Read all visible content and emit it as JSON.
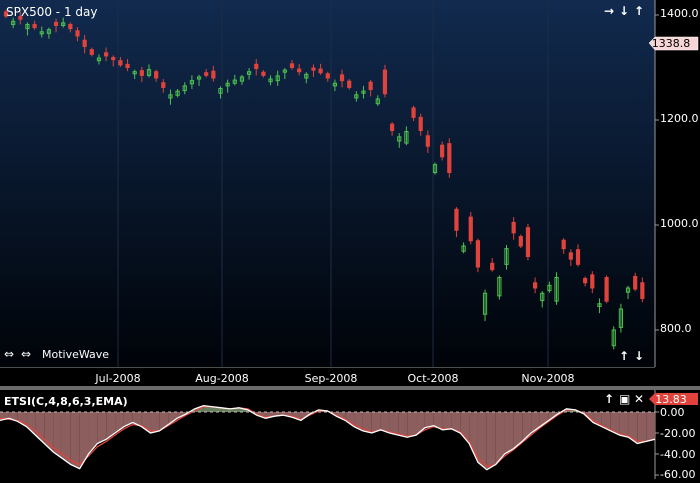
{
  "price_panel": {
    "title": "SPX500 - 1 day",
    "last_price": "1338.8",
    "price_ticks": [
      "1400.0",
      "1200.0",
      "1000.0",
      "800.0"
    ],
    "brand": "MotiveWave",
    "controls": {
      "top": [
        "→",
        "↓",
        "↑"
      ],
      "bottom": [
        "↑",
        "↓"
      ]
    }
  },
  "time_axis": {
    "labels": [
      "Jul-2008",
      "Aug-2008",
      "Sep-2008",
      "Oct-2008",
      "Nov-2008"
    ]
  },
  "indicator_panel": {
    "title": "ETSI(C,4,8,6,3,EMA)",
    "last_value": "13.83",
    "ticks": [
      "0.00",
      "-20.00",
      "-40.00",
      "-60.00"
    ],
    "controls": [
      "↑",
      "▣",
      "✕"
    ]
  },
  "colors": {
    "up_candle": "#4ec24e",
    "down_candle": "#e0433c",
    "tsi_line": "#ffffff",
    "signal_line": "#e0433c",
    "fill_positive": "#6a7f5e",
    "fill_negative": "#8c5e5e",
    "last_price_box": "#f5d5d5",
    "last_value_box": "#e0433c"
  },
  "chart_data": [
    {
      "type": "candlestick",
      "title": "SPX500 - 1 day",
      "y_axis": {
        "ticks": [
          800,
          1000,
          1200,
          1400
        ],
        "range": [
          735,
          1420
        ]
      },
      "x_axis": {
        "labels": [
          "Jul-2008",
          "Aug-2008",
          "Sep-2008",
          "Oct-2008",
          "Nov-2008"
        ]
      },
      "last_value": 1338.8,
      "close": [
        1398,
        1388,
        1392,
        1382,
        1376,
        1368,
        1372,
        1380,
        1385,
        1374,
        1360,
        1340,
        1325,
        1318,
        1322,
        1315,
        1305,
        1300,
        1292,
        1285,
        1296,
        1280,
        1262,
        1248,
        1255,
        1265,
        1275,
        1282,
        1285,
        1280,
        1260,
        1270,
        1276,
        1282,
        1292,
        1298,
        1285,
        1278,
        1284,
        1295,
        1300,
        1292,
        1287,
        1295,
        1290,
        1280,
        1270,
        1275,
        1262,
        1248,
        1255,
        1258,
        1240,
        1250,
        1180,
        1168,
        1178,
        1205,
        1180,
        1150,
        1115,
        1130,
        1100,
        990,
        960,
        970,
        920,
        870,
        915,
        900,
        955,
        985,
        960,
        940,
        880,
        870,
        885,
        900,
        955,
        935,
        925,
        890,
        880,
        850,
        855,
        800,
        840,
        880,
        878,
        860
      ],
      "open_offset": [
        8,
        -6,
        5,
        -8,
        6,
        -4,
        -7,
        6,
        -5,
        8,
        10,
        12,
        9,
        -5,
        6,
        4,
        8,
        6,
        -4,
        9,
        -11,
        12,
        9,
        -6,
        -8,
        -9,
        -6,
        -4,
        5,
        13,
        -9,
        -5,
        -6,
        -8,
        -5,
        8,
        6,
        -5,
        -9,
        -4,
        7,
        5,
        -7,
        4,
        7,
        8,
        -5,
        11,
        12,
        -6,
        -4,
        14,
        -9,
        45,
        12,
        -8,
        -22,
        18,
        25,
        20,
        -15,
        22,
        55,
        40,
        -10,
        45,
        50,
        -40,
        12,
        -35,
        -30,
        20,
        18,
        55,
        10,
        -14,
        -10,
        -45,
        16,
        12,
        28,
        8,
        25,
        -5,
        45,
        -30,
        -35,
        -8,
        24,
        30
      ]
    },
    {
      "type": "area",
      "title": "ETSI(C,4,8,6,3,EMA)",
      "y_axis": {
        "ticks": [
          0,
          -20,
          -40,
          -60
        ],
        "range": [
          -68,
          8
        ]
      },
      "last_value": 13.83,
      "tsi": [
        -8,
        -6,
        -9,
        -14,
        -22,
        -30,
        -38,
        -44,
        -50,
        -54,
        -40,
        -30,
        -26,
        -20,
        -14,
        -10,
        -14,
        -20,
        -18,
        -12,
        -6,
        -2,
        3,
        6,
        5,
        4,
        3,
        4,
        2,
        -3,
        -6,
        -4,
        -3,
        -5,
        -8,
        -2,
        2,
        1,
        -4,
        -8,
        -14,
        -18,
        -20,
        -17,
        -20,
        -22,
        -24,
        -22,
        -15,
        -13,
        -17,
        -16,
        -20,
        -30,
        -48,
        -55,
        -50,
        -40,
        -35,
        -28,
        -20,
        -14,
        -8,
        -2,
        3,
        2,
        -2,
        -10,
        -14,
        -18,
        -22,
        -24,
        -30,
        -28,
        -26
      ],
      "signal": [
        -6,
        -7,
        -8,
        -12,
        -18,
        -26,
        -34,
        -40,
        -46,
        -50,
        -42,
        -33,
        -28,
        -22,
        -16,
        -12,
        -13,
        -18,
        -18,
        -13,
        -8,
        -3,
        1,
        5,
        5,
        4,
        3,
        4,
        3,
        -2,
        -5,
        -4,
        -3,
        -4,
        -7,
        -3,
        1,
        1,
        -3,
        -7,
        -12,
        -16,
        -19,
        -17,
        -19,
        -21,
        -23,
        -22,
        -17,
        -14,
        -16,
        -16,
        -19,
        -28,
        -44,
        -52,
        -50,
        -42,
        -36,
        -29,
        -22,
        -15,
        -9,
        -3,
        2,
        2,
        -1,
        -8,
        -13,
        -17,
        -21,
        -23,
        -28,
        -28,
        -26
      ]
    }
  ]
}
